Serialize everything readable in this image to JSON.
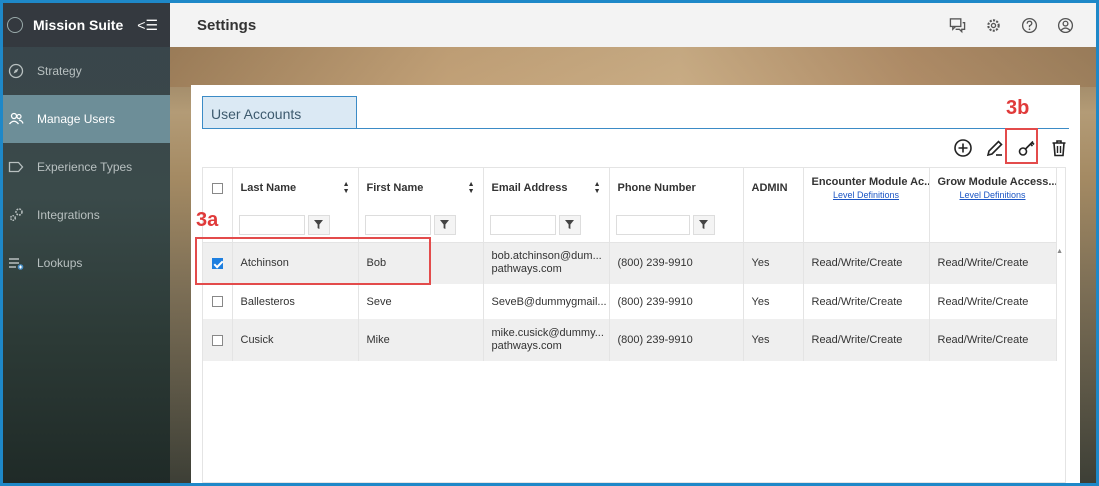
{
  "app": {
    "title": "Mission Suite",
    "collapse_glyph": "<☰"
  },
  "sidebar": {
    "items": [
      {
        "label": "Strategy",
        "icon": "compass-icon",
        "active": false
      },
      {
        "label": "Manage Users",
        "icon": "users-icon",
        "active": true
      },
      {
        "label": "Experience Types",
        "icon": "tag-icon",
        "active": false
      },
      {
        "label": "Integrations",
        "icon": "gears-icon",
        "active": false
      },
      {
        "label": "Lookups",
        "icon": "list-add-icon",
        "active": false
      }
    ]
  },
  "header": {
    "title": "Settings",
    "icons": [
      "chat-icon",
      "gear-icon",
      "help-icon",
      "user-account-icon"
    ]
  },
  "card": {
    "tab_label": "User Accounts",
    "toolbar": [
      "add-icon",
      "edit-icon",
      "key-icon",
      "trash-icon"
    ]
  },
  "grid": {
    "columns": [
      {
        "label": "Last Name",
        "sortable": true,
        "filter": true
      },
      {
        "label": "First Name",
        "sortable": true,
        "filter": true
      },
      {
        "label": "Email Address",
        "sortable": true,
        "filter": true
      },
      {
        "label": "Phone Number",
        "sortable": false,
        "filter": true
      },
      {
        "label": "ADMIN",
        "sortable": false,
        "filter": false
      },
      {
        "label": "Encounter Module Ac...",
        "sub_link": "Level Definitions",
        "filter": false
      },
      {
        "label": "Grow Module Access...",
        "sub_link": "Level Definitions",
        "filter": false
      }
    ],
    "rows": [
      {
        "checked": true,
        "last": "Atchinson",
        "first": "Bob",
        "email1": "bob.atchinson@dum...",
        "email2": "pathways.com",
        "phone": "(800) 239-9910",
        "admin": "Yes",
        "encounter": "Read/Write/Create",
        "grow": "Read/Write/Create"
      },
      {
        "checked": false,
        "last": "Ballesteros",
        "first": "Seve",
        "email1": "SeveB@dummygmail...",
        "email2": "",
        "phone": "(800) 239-9910",
        "admin": "Yes",
        "encounter": "Read/Write/Create",
        "grow": "Read/Write/Create"
      },
      {
        "checked": false,
        "last": "Cusick",
        "first": "Mike",
        "email1": "mike.cusick@dummy...",
        "email2": "pathways.com",
        "phone": "(800) 239-9910",
        "admin": "Yes",
        "encounter": "Read/Write/Create",
        "grow": "Read/Write/Create"
      }
    ]
  },
  "annotations": {
    "label_a": "3a",
    "label_b": "3b",
    "color": "#e34b4b"
  }
}
